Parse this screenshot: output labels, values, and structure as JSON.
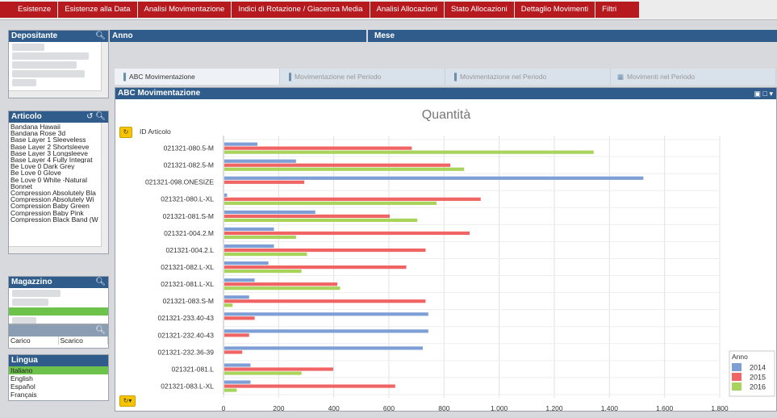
{
  "top_tabs": [
    "Esistenze",
    "Esistenze alla Data",
    "Analisi Movimentazione",
    "Indici di Rotazione / Giacenza Media",
    "Analisi Allocazioni",
    "Stato Allocazioni",
    "Dettaglio Movimenti",
    "Filtri"
  ],
  "left": {
    "depositante_title": "Depositante",
    "articolo_title": "Articolo",
    "articolo_items": [
      "Bandana Hawaii",
      "Bandana Rose 3d",
      "Base Layer 1 Sleeveless",
      "Base Layer 2 Shortsleeve",
      "Base Layer 3 Longsleeve",
      "Base Layer 4 Fully Integrat",
      "Be Love 0 Dark Grey",
      "Be Love 0 Glove",
      "Be Love 0 White -Natural",
      "Bonnet",
      "Compression Absolutely Bla",
      "Compression Absolutely Wi",
      "Compression Baby Green",
      "Compression Baby Pink",
      "Compression Black Band (W"
    ],
    "magazzino_title": "Magazzino",
    "tipo_movimento": [
      "Carico",
      "Scarico"
    ],
    "lingua_title": "Lingua",
    "lingua_items": [
      "Italiano",
      "English",
      "Español",
      "Français"
    ],
    "lingua_selected": "Italiano"
  },
  "anno_label": "Anno",
  "mese_label": "Mese",
  "chart_tabs": [
    {
      "label": "ABC Movimentazione",
      "active": true,
      "icon": "bar-chart-icon"
    },
    {
      "label": "Movimentazione nel Periodo",
      "active": false,
      "icon": "bar-chart-icon"
    },
    {
      "label": "Movimentazione nel Periodo",
      "active": false,
      "icon": "bar-chart-icon"
    },
    {
      "label": "Movimenti nel Periodo",
      "active": false,
      "icon": "table-icon"
    }
  ],
  "chart_panel_title": "ABC Movimentazione",
  "dimension_label": "ID Articolo",
  "colors": {
    "s2014": "#7e9fd6",
    "s2015": "#f06464",
    "s2016": "#a8d45c",
    "header": "#2f5c8b",
    "tab": "#b61a1f",
    "green_sel": "#6cc24a"
  },
  "chart_data": {
    "type": "bar",
    "orientation": "horizontal",
    "title": "Quantità",
    "categories": [
      "021321-080.5-M",
      "021321-082.5-M",
      "021321-098.ONESIZE",
      "021321-080.L-XL",
      "021321-081.S-M",
      "021321-004.2.M",
      "021321-004.2.L",
      "021321-082.L-XL",
      "021321-081.L-XL",
      "021321-083.S-M",
      "021321-233.40-43",
      "021321-232.40-43",
      "021321-232.36-39",
      "021321-081.L",
      "021321-083.L-XL"
    ],
    "series": [
      {
        "name": "2014",
        "values": [
          120,
          260,
          1520,
          10,
          330,
          180,
          180,
          160,
          110,
          90,
          740,
          740,
          720,
          95,
          95
        ]
      },
      {
        "name": "2015",
        "values": [
          680,
          820,
          290,
          930,
          600,
          890,
          730,
          660,
          410,
          730,
          110,
          90,
          65,
          395,
          620
        ]
      },
      {
        "name": "2016",
        "values": [
          1340,
          870,
          0,
          770,
          700,
          260,
          300,
          280,
          420,
          30,
          0,
          0,
          0,
          280,
          45
        ]
      }
    ],
    "xlim": [
      0,
      1800
    ],
    "xticks": [
      "0",
      "200",
      "400",
      "600",
      "800",
      "1.000",
      "1.200",
      "1.400",
      "1.600",
      "1.800"
    ],
    "legend_title": "Anno",
    "legend_placement": "bottom-right",
    "grid": true
  }
}
